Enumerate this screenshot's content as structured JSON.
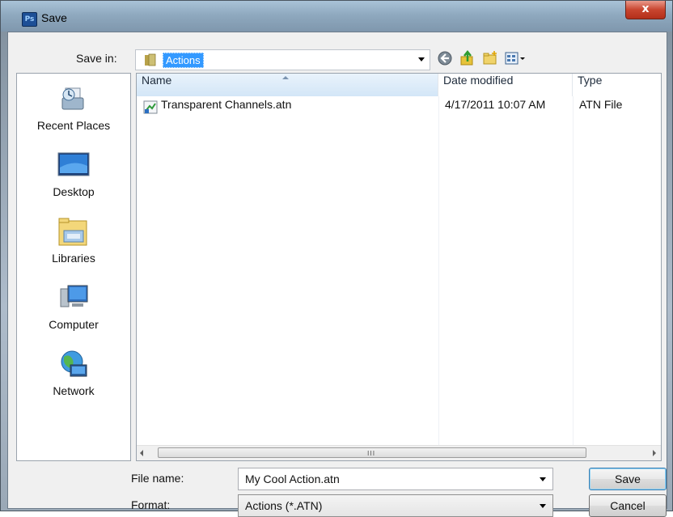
{
  "window": {
    "title": "Save",
    "app_icon_text": "Ps",
    "close_glyph": "x"
  },
  "toolbar": {
    "save_in_label": "Save in:",
    "save_in_value": "Actions",
    "icons": [
      "back-arrow-icon",
      "up-folder-icon",
      "new-folder-icon",
      "view-menu-icon"
    ]
  },
  "places": [
    {
      "label": "Recent Places",
      "icon": "recent-places-icon"
    },
    {
      "label": "Desktop",
      "icon": "desktop-icon"
    },
    {
      "label": "Libraries",
      "icon": "libraries-icon"
    },
    {
      "label": "Computer",
      "icon": "computer-icon"
    },
    {
      "label": "Network",
      "icon": "network-icon"
    }
  ],
  "file_list": {
    "columns": [
      "Name",
      "Date modified",
      "Type"
    ],
    "rows": [
      {
        "name": "Transparent Channels.atn",
        "date": "4/17/2011 10:07 AM",
        "type": "ATN File"
      }
    ],
    "scroll_grip": "III"
  },
  "form": {
    "file_name_label": "File name:",
    "file_name_value": "My Cool Action.atn",
    "format_label": "Format:",
    "format_value": "Actions (*.ATN)"
  },
  "buttons": {
    "save": "Save",
    "cancel": "Cancel"
  },
  "colors": {
    "selection": "#3399ff",
    "close_button": "#c8452f"
  }
}
